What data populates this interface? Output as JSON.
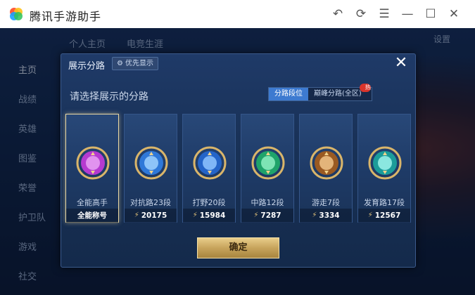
{
  "window": {
    "title": "腾讯手游助手"
  },
  "background": {
    "tabs": [
      "个人主页",
      "电竞生涯"
    ],
    "settings_label": "设置",
    "nav": [
      "主页",
      "战绩",
      "英雄",
      "图鉴",
      "荣誉",
      "护卫队",
      "游戏",
      "社交"
    ]
  },
  "dialog": {
    "title": "展示分路",
    "pref_label": "优先显示",
    "subtitle": "请选择展示的分路",
    "segments": {
      "active": "分路段位",
      "inactive": "巅峰分路(全区)"
    },
    "cards": [
      {
        "title": "全能高手",
        "footer": "全能称号",
        "badge": "purple",
        "selected": true,
        "show_power": false
      },
      {
        "title": "对抗路23段",
        "footer": "20175",
        "badge": "blue-sword",
        "selected": false,
        "show_power": true
      },
      {
        "title": "打野20段",
        "footer": "15984",
        "badge": "blue-dragon",
        "selected": false,
        "show_power": true
      },
      {
        "title": "中路12段",
        "footer": "7287",
        "badge": "green",
        "selected": false,
        "show_power": true
      },
      {
        "title": "游走7段",
        "footer": "3334",
        "badge": "bronze-shield",
        "selected": false,
        "show_power": true
      },
      {
        "title": "发育路17段",
        "footer": "12567",
        "badge": "teal",
        "selected": false,
        "show_power": true
      }
    ],
    "confirm_label": "确定"
  },
  "colors": {
    "accent": "#3d7ad0",
    "gold": "#c7a45c"
  }
}
